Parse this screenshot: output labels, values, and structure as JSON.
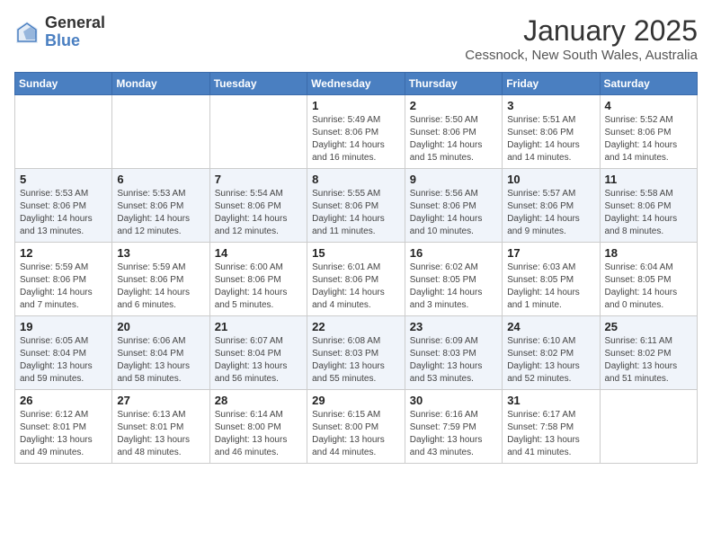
{
  "header": {
    "logo_general": "General",
    "logo_blue": "Blue",
    "month_title": "January 2025",
    "location": "Cessnock, New South Wales, Australia"
  },
  "weekdays": [
    "Sunday",
    "Monday",
    "Tuesday",
    "Wednesday",
    "Thursday",
    "Friday",
    "Saturday"
  ],
  "weeks": [
    [
      {
        "day": "",
        "info": ""
      },
      {
        "day": "",
        "info": ""
      },
      {
        "day": "",
        "info": ""
      },
      {
        "day": "1",
        "info": "Sunrise: 5:49 AM\nSunset: 8:06 PM\nDaylight: 14 hours\nand 16 minutes."
      },
      {
        "day": "2",
        "info": "Sunrise: 5:50 AM\nSunset: 8:06 PM\nDaylight: 14 hours\nand 15 minutes."
      },
      {
        "day": "3",
        "info": "Sunrise: 5:51 AM\nSunset: 8:06 PM\nDaylight: 14 hours\nand 14 minutes."
      },
      {
        "day": "4",
        "info": "Sunrise: 5:52 AM\nSunset: 8:06 PM\nDaylight: 14 hours\nand 14 minutes."
      }
    ],
    [
      {
        "day": "5",
        "info": "Sunrise: 5:53 AM\nSunset: 8:06 PM\nDaylight: 14 hours\nand 13 minutes."
      },
      {
        "day": "6",
        "info": "Sunrise: 5:53 AM\nSunset: 8:06 PM\nDaylight: 14 hours\nand 12 minutes."
      },
      {
        "day": "7",
        "info": "Sunrise: 5:54 AM\nSunset: 8:06 PM\nDaylight: 14 hours\nand 12 minutes."
      },
      {
        "day": "8",
        "info": "Sunrise: 5:55 AM\nSunset: 8:06 PM\nDaylight: 14 hours\nand 11 minutes."
      },
      {
        "day": "9",
        "info": "Sunrise: 5:56 AM\nSunset: 8:06 PM\nDaylight: 14 hours\nand 10 minutes."
      },
      {
        "day": "10",
        "info": "Sunrise: 5:57 AM\nSunset: 8:06 PM\nDaylight: 14 hours\nand 9 minutes."
      },
      {
        "day": "11",
        "info": "Sunrise: 5:58 AM\nSunset: 8:06 PM\nDaylight: 14 hours\nand 8 minutes."
      }
    ],
    [
      {
        "day": "12",
        "info": "Sunrise: 5:59 AM\nSunset: 8:06 PM\nDaylight: 14 hours\nand 7 minutes."
      },
      {
        "day": "13",
        "info": "Sunrise: 5:59 AM\nSunset: 8:06 PM\nDaylight: 14 hours\nand 6 minutes."
      },
      {
        "day": "14",
        "info": "Sunrise: 6:00 AM\nSunset: 8:06 PM\nDaylight: 14 hours\nand 5 minutes."
      },
      {
        "day": "15",
        "info": "Sunrise: 6:01 AM\nSunset: 8:06 PM\nDaylight: 14 hours\nand 4 minutes."
      },
      {
        "day": "16",
        "info": "Sunrise: 6:02 AM\nSunset: 8:05 PM\nDaylight: 14 hours\nand 3 minutes."
      },
      {
        "day": "17",
        "info": "Sunrise: 6:03 AM\nSunset: 8:05 PM\nDaylight: 14 hours\nand 1 minute."
      },
      {
        "day": "18",
        "info": "Sunrise: 6:04 AM\nSunset: 8:05 PM\nDaylight: 14 hours\nand 0 minutes."
      }
    ],
    [
      {
        "day": "19",
        "info": "Sunrise: 6:05 AM\nSunset: 8:04 PM\nDaylight: 13 hours\nand 59 minutes."
      },
      {
        "day": "20",
        "info": "Sunrise: 6:06 AM\nSunset: 8:04 PM\nDaylight: 13 hours\nand 58 minutes."
      },
      {
        "day": "21",
        "info": "Sunrise: 6:07 AM\nSunset: 8:04 PM\nDaylight: 13 hours\nand 56 minutes."
      },
      {
        "day": "22",
        "info": "Sunrise: 6:08 AM\nSunset: 8:03 PM\nDaylight: 13 hours\nand 55 minutes."
      },
      {
        "day": "23",
        "info": "Sunrise: 6:09 AM\nSunset: 8:03 PM\nDaylight: 13 hours\nand 53 minutes."
      },
      {
        "day": "24",
        "info": "Sunrise: 6:10 AM\nSunset: 8:02 PM\nDaylight: 13 hours\nand 52 minutes."
      },
      {
        "day": "25",
        "info": "Sunrise: 6:11 AM\nSunset: 8:02 PM\nDaylight: 13 hours\nand 51 minutes."
      }
    ],
    [
      {
        "day": "26",
        "info": "Sunrise: 6:12 AM\nSunset: 8:01 PM\nDaylight: 13 hours\nand 49 minutes."
      },
      {
        "day": "27",
        "info": "Sunrise: 6:13 AM\nSunset: 8:01 PM\nDaylight: 13 hours\nand 48 minutes."
      },
      {
        "day": "28",
        "info": "Sunrise: 6:14 AM\nSunset: 8:00 PM\nDaylight: 13 hours\nand 46 minutes."
      },
      {
        "day": "29",
        "info": "Sunrise: 6:15 AM\nSunset: 8:00 PM\nDaylight: 13 hours\nand 44 minutes."
      },
      {
        "day": "30",
        "info": "Sunrise: 6:16 AM\nSunset: 7:59 PM\nDaylight: 13 hours\nand 43 minutes."
      },
      {
        "day": "31",
        "info": "Sunrise: 6:17 AM\nSunset: 7:58 PM\nDaylight: 13 hours\nand 41 minutes."
      },
      {
        "day": "",
        "info": ""
      }
    ]
  ]
}
